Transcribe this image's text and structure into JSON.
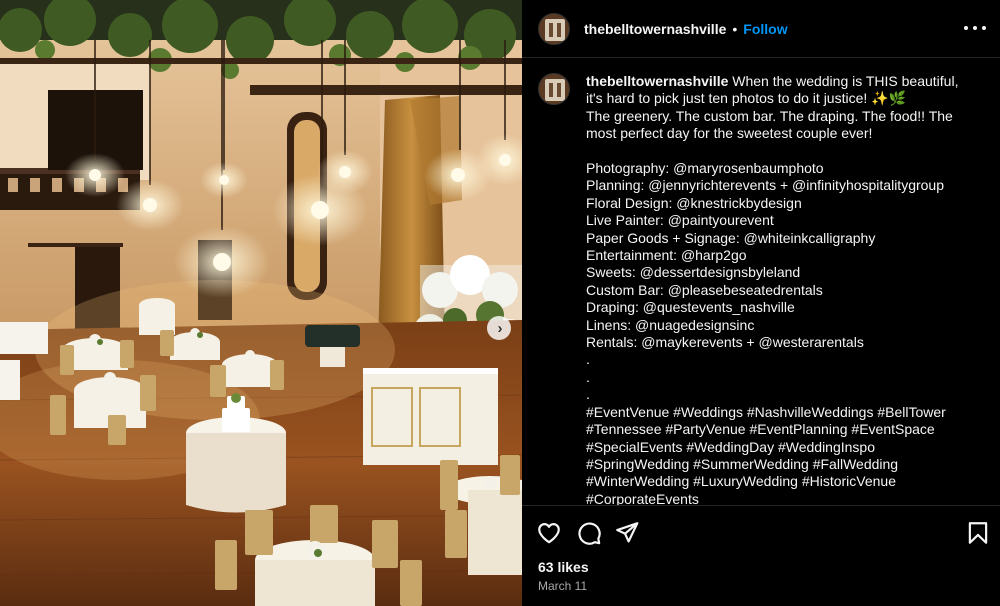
{
  "photo": {
    "alt_icon": "wedding-venue-photo",
    "next_icon": "chevron-right-icon",
    "next_glyph": "›"
  },
  "header": {
    "username": "thebelltowernashville",
    "separator": "•",
    "follow_label": "Follow",
    "more_icon": "more-horizontal-icon"
  },
  "caption": {
    "username": "thebelltowernashville",
    "lines": [
      " When the wedding is THIS beautiful,",
      "it's hard to pick just ten photos to do it justice! ✨🌿",
      "The greenery. The custom bar. The draping. The food!! The",
      "most perfect day for the sweetest couple ever!",
      "",
      "Photography: @maryrosenbaumphoto",
      "Planning: @jennyrichterevents + @infinityhospitalitygroup",
      "Floral Design: @knestrickbydesign",
      "Live Painter: @paintyourevent",
      "Paper Goods + Signage: @whiteinkcalligraphy",
      "Entertainment: @harp2go",
      "Sweets: @dessertdesignsbyleland",
      "Custom Bar: @pleasebeseatedrentals",
      "Draping: @questevents_nashville",
      "Linens: @nuagedesignsinc",
      "Rentals: @maykerevents + @westerarentals",
      ".",
      ".",
      ".",
      "#EventVenue #Weddings #NashvilleWeddings #BellTower",
      "#Tennessee #PartyVenue #EventPlanning #EventSpace",
      "#SpecialEvents #WeddingDay #WeddingInspo",
      "#SpringWedding #SummerWedding #FallWedding",
      "#WinterWedding #LuxuryWedding #HistoricVenue",
      "#CorporateEvents"
    ]
  },
  "actions": {
    "like_icon": "heart-icon",
    "comment_icon": "comment-icon",
    "share_icon": "paper-plane-icon",
    "save_icon": "bookmark-icon",
    "likes_text": "63 likes",
    "date_text": "March 11"
  }
}
